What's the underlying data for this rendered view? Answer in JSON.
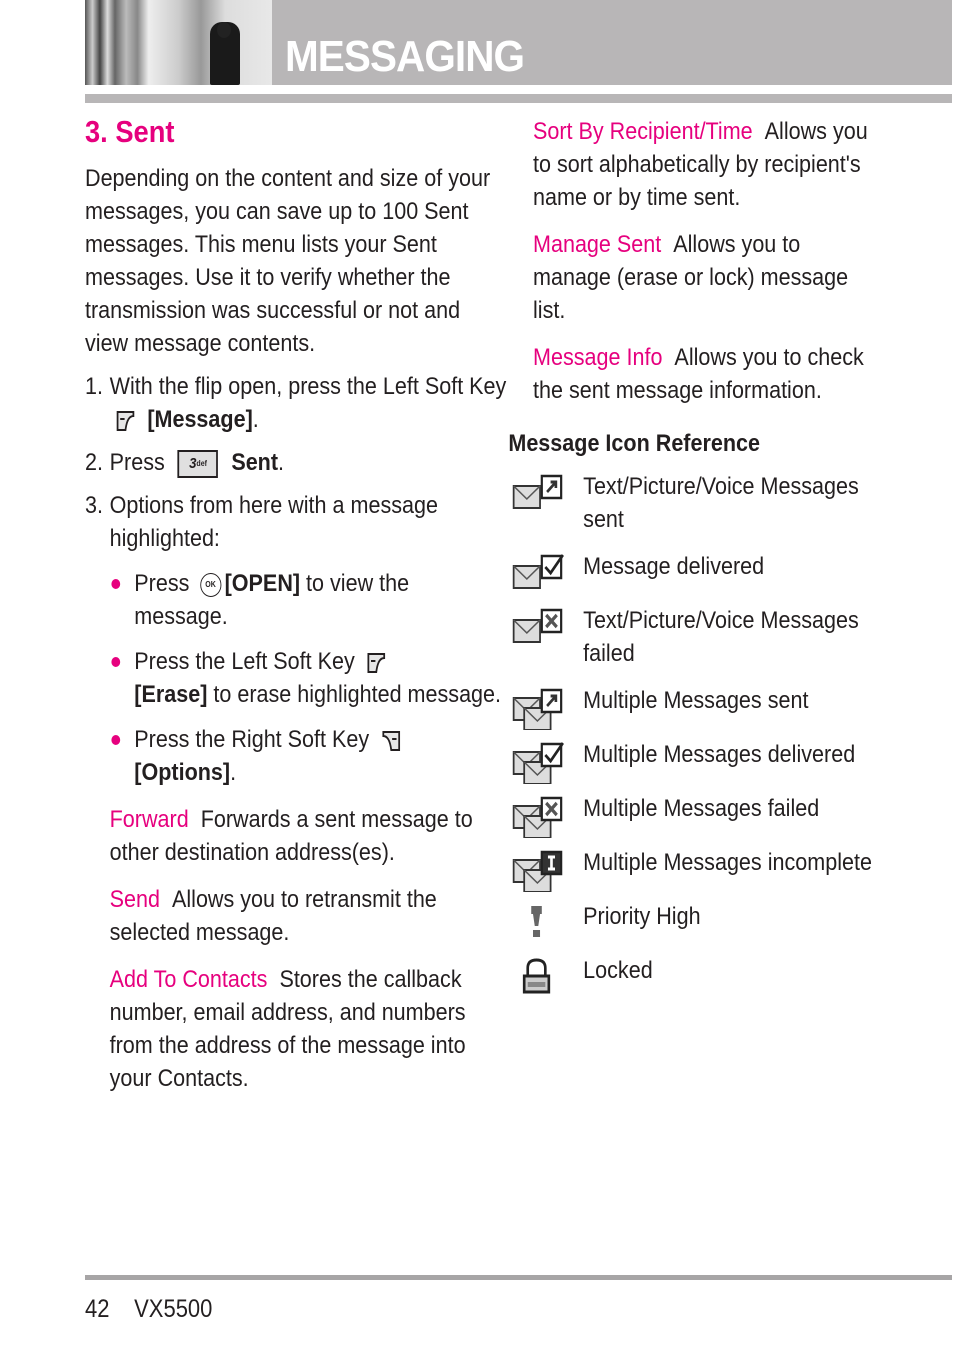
{
  "header": {
    "title": "MESSAGING"
  },
  "section": {
    "title": "3. Sent",
    "intro": "Depending on the content and size of your messages, you can save up to 100 Sent messages. This menu lists your Sent messages. Use it to verify whether the transmission was successful or not and view message contents."
  },
  "steps": [
    {
      "num": "1.",
      "text": "With the flip open, press the Left Soft Key",
      "key": "left-soft-key",
      "bold": "[Message]",
      "end": "."
    },
    {
      "num": "2.",
      "text": "Press",
      "key": "3-def-key",
      "key_label": "3",
      "key_sub": "def",
      "bold": "Sent",
      "end": "."
    },
    {
      "num": "3.",
      "text": "Options from here with a message highlighted:"
    }
  ],
  "bullets": [
    {
      "pre": "Press",
      "key": "ok-key",
      "key_label": "OK",
      "bold": "[OPEN]",
      "post": " to view the message."
    },
    {
      "pre": "Press the Left Soft Key",
      "key": "left-soft-key",
      "bold": "[Erase]",
      "post": " to erase highlighted message."
    },
    {
      "pre": "Press the Right Soft Key",
      "key": "right-soft-key",
      "bold": "[Options]",
      "post": "."
    }
  ],
  "options_left": [
    {
      "name": "Forward",
      "desc": "Forwards a sent message to other destination address(es)."
    },
    {
      "name": "Send",
      "desc": "Allows you to retransmit the selected message."
    },
    {
      "name": "Add To Contacts",
      "desc": "Stores the callback number, email address, and numbers from the address of the message into your Contacts."
    }
  ],
  "options_right": [
    {
      "name": "Sort By Recipient/Time",
      "desc": "Allows you to sort alphabetically by recipient's name or by time sent."
    },
    {
      "name": "Manage Sent",
      "desc": "Allows you to manage (erase or lock) message list."
    },
    {
      "name": "Message Info",
      "desc": "Allows you to check the sent message information."
    }
  ],
  "icon_reference": {
    "title": "Message Icon Reference",
    "items": [
      {
        "icon": "message-sent-icon",
        "label": "Text/Picture/Voice Messages sent"
      },
      {
        "icon": "message-delivered-icon",
        "label": "Message delivered"
      },
      {
        "icon": "message-failed-icon",
        "label": "Text/Picture/Voice Messages failed"
      },
      {
        "icon": "multiple-sent-icon",
        "label": "Multiple Messages sent"
      },
      {
        "icon": "multiple-delivered-icon",
        "label": "Multiple Messages delivered"
      },
      {
        "icon": "multiple-failed-icon",
        "label": "Multiple Messages failed"
      },
      {
        "icon": "multiple-incomplete-icon",
        "label": "Multiple Messages incomplete"
      },
      {
        "icon": "priority-high-icon",
        "label": "Priority High"
      },
      {
        "icon": "locked-icon",
        "label": "Locked"
      }
    ]
  },
  "footer": {
    "page": "42",
    "model": "VX5500"
  },
  "colors": {
    "accent": "#e6007e",
    "header_gray": "#b8b6b7",
    "text": "#231f20"
  }
}
